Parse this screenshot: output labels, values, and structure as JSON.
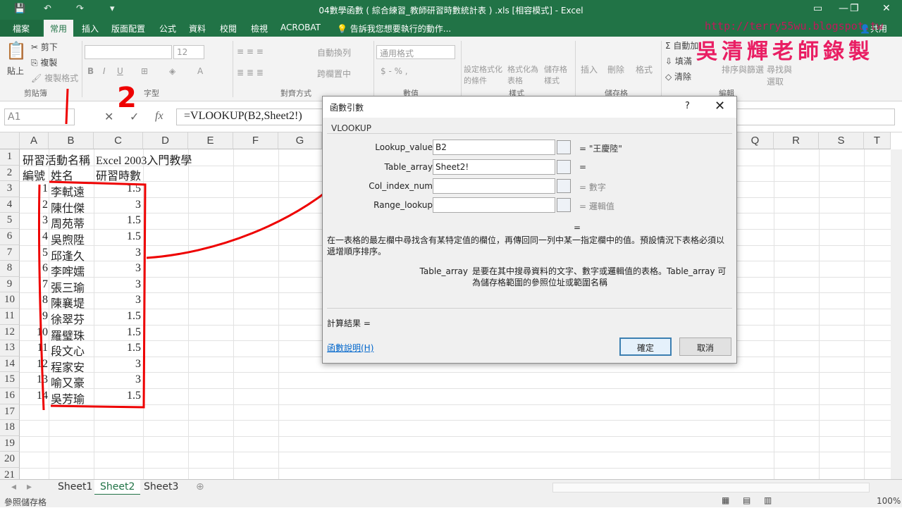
{
  "window": {
    "title": "04數學函數 ( 綜合練習_教師研習時數統計表 ) .xls [相容模式] - Excel",
    "controls": [
      "—",
      "❐",
      "✕"
    ]
  },
  "watermark": {
    "url": "http://terry55wu.blogspot.tw",
    "name": "吳清輝老師錄製"
  },
  "annotation": {
    "number": "2"
  },
  "ribbon_tabs": [
    "檔案",
    "常用",
    "插入",
    "版面配置",
    "公式",
    "資料",
    "校閱",
    "檢視",
    "ACROBAT"
  ],
  "tell_me": "告訴我您想要執行的動作...",
  "share": "共用",
  "ribbon": {
    "clipboard": {
      "paste": "貼上",
      "cut": "剪下",
      "copy": "複製",
      "format_painter": "複製格式",
      "group": "剪貼簿"
    },
    "font": {
      "font_size": "12",
      "bold": "B",
      "italic": "I",
      "underline": "U",
      "group": "字型"
    },
    "alignment": {
      "wrap": "自動換列",
      "merge": "跨欄置中",
      "group": "對齊方式"
    },
    "number": {
      "format": "通用格式",
      "group": "數值"
    },
    "styles": {
      "conditional": "設定格式化的條件",
      "table": "格式化為表格",
      "cell": "儲存格樣式",
      "group": "樣式"
    },
    "cells": {
      "insert": "插入",
      "delete": "刪除",
      "format": "格式",
      "group": "儲存格"
    },
    "editing": {
      "autosum": "自動加",
      "fill": "填滿",
      "clear": "清除",
      "sort": "排序與篩選",
      "find": "尋找與選取",
      "group": "編輯"
    }
  },
  "formula_bar": {
    "name_box": "A1",
    "cancel": "✕",
    "confirm": "✓",
    "fx": "fx",
    "formula": "=VLOOKUP(B2,Sheet2!)"
  },
  "grid": {
    "columns": [
      "A",
      "B",
      "C",
      "D",
      "E",
      "F",
      "G",
      "Q",
      "R",
      "S",
      "T"
    ],
    "rows": [
      "1",
      "2",
      "3",
      "4",
      "5",
      "6",
      "7",
      "8",
      "9",
      "10",
      "11",
      "12",
      "13",
      "14",
      "15",
      "16",
      "17",
      "18",
      "19",
      "20",
      "21"
    ],
    "row1": {
      "a": "研習活動名稱",
      "c": "Excel 2003入門教學"
    },
    "row2": {
      "a": "編號",
      "b": "姓名",
      "c": "研習時數"
    },
    "data": [
      {
        "no": "1",
        "name": "李軾遠",
        "hours": "1.5"
      },
      {
        "no": "2",
        "name": "陳仕傑",
        "hours": "3"
      },
      {
        "no": "3",
        "name": "周苑蒂",
        "hours": "1.5"
      },
      {
        "no": "4",
        "name": "吳煦陞",
        "hours": "1.5"
      },
      {
        "no": "5",
        "name": "邱逢久",
        "hours": "3"
      },
      {
        "no": "6",
        "name": "李哰嬬",
        "hours": "3"
      },
      {
        "no": "7",
        "name": "張三瑜",
        "hours": "3"
      },
      {
        "no": "8",
        "name": "陳襄堤",
        "hours": "3"
      },
      {
        "no": "9",
        "name": "徐翠芬",
        "hours": "1.5"
      },
      {
        "no": "10",
        "name": "羅璧珠",
        "hours": "1.5"
      },
      {
        "no": "11",
        "name": "段文心",
        "hours": "1.5"
      },
      {
        "no": "12",
        "name": "程家安",
        "hours": "3"
      },
      {
        "no": "13",
        "name": "喻又豪",
        "hours": "3"
      },
      {
        "no": "14",
        "name": "吳芳瑜",
        "hours": "1.5"
      }
    ]
  },
  "sheets": [
    "Sheet1",
    "Sheet2",
    "Sheet3"
  ],
  "status": {
    "mode": "參照儲存格",
    "zoom": "100%"
  },
  "dialog": {
    "title": "函數引數",
    "help": "?",
    "close": "✕",
    "function": "VLOOKUP",
    "args": [
      {
        "label": "Lookup_value",
        "value": "B2",
        "result": "= \"王慶陸\""
      },
      {
        "label": "Table_array",
        "value": "Sheet2!",
        "result": "="
      },
      {
        "label": "Col_index_num",
        "value": "",
        "result": "= 數字"
      },
      {
        "label": "Range_lookup",
        "value": "",
        "result": "= 邏輯值"
      }
    ],
    "eq": "=",
    "description": "在一表格的最左欄中尋找含有某特定值的欄位，再傳回同一列中某一指定欄中的值。預設情況下表格必須以遞增順序排序。",
    "param_name": "Table_array",
    "param_desc": "是要在其中搜尋資料的文字、數字或邏輯值的表格。Table_array 可為儲存格範圍的參照位址或範圍名稱",
    "result_label": "計算結果 =",
    "help_link": "函數說明(H)",
    "ok": "確定",
    "cancel": "取消"
  }
}
